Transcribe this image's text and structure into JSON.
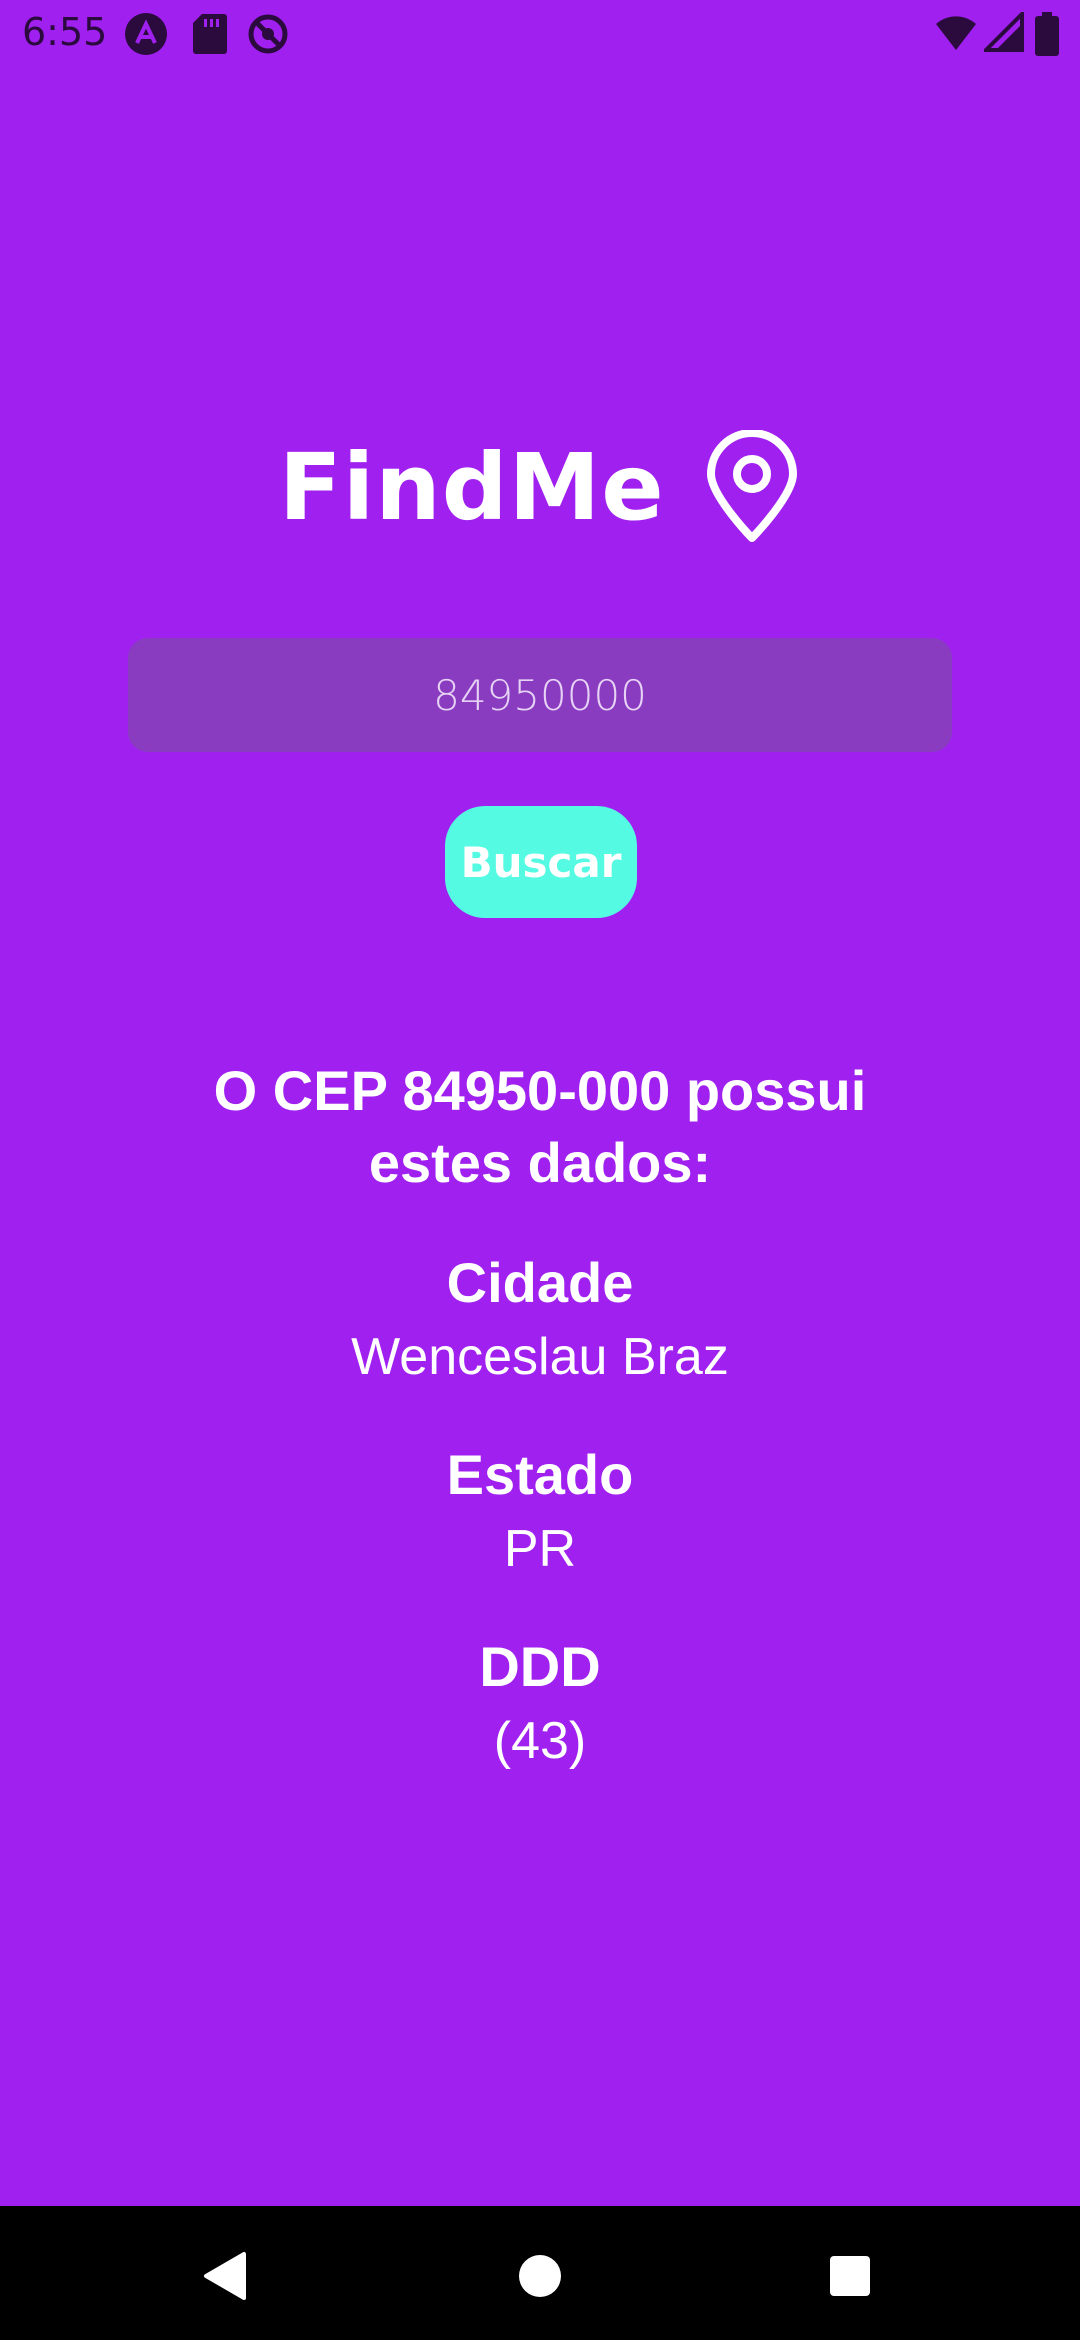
{
  "status_bar": {
    "time": "6:55",
    "left_icons": [
      "expo-icon",
      "sd-card-icon",
      "sync-icon"
    ],
    "right_icons": [
      "wifi-icon",
      "signal-icon",
      "battery-icon"
    ]
  },
  "app": {
    "title": "FindMe",
    "title_icon": "location-pin-icon"
  },
  "search": {
    "value": "",
    "placeholder": "84950000",
    "button_label": "Buscar"
  },
  "result": {
    "heading": "O CEP 84950-000 possui estes dados:",
    "fields": [
      {
        "label": "Cidade",
        "value": "Wenceslau Braz"
      },
      {
        "label": "Estado",
        "value": "PR"
      },
      {
        "label": "DDD",
        "value": "(43)"
      }
    ]
  },
  "colors": {
    "background": "#a020f0",
    "input_background": "#8a3cc1",
    "button_background": "#55fae2",
    "text": "#ffffff",
    "nav_bar": "#000000"
  }
}
